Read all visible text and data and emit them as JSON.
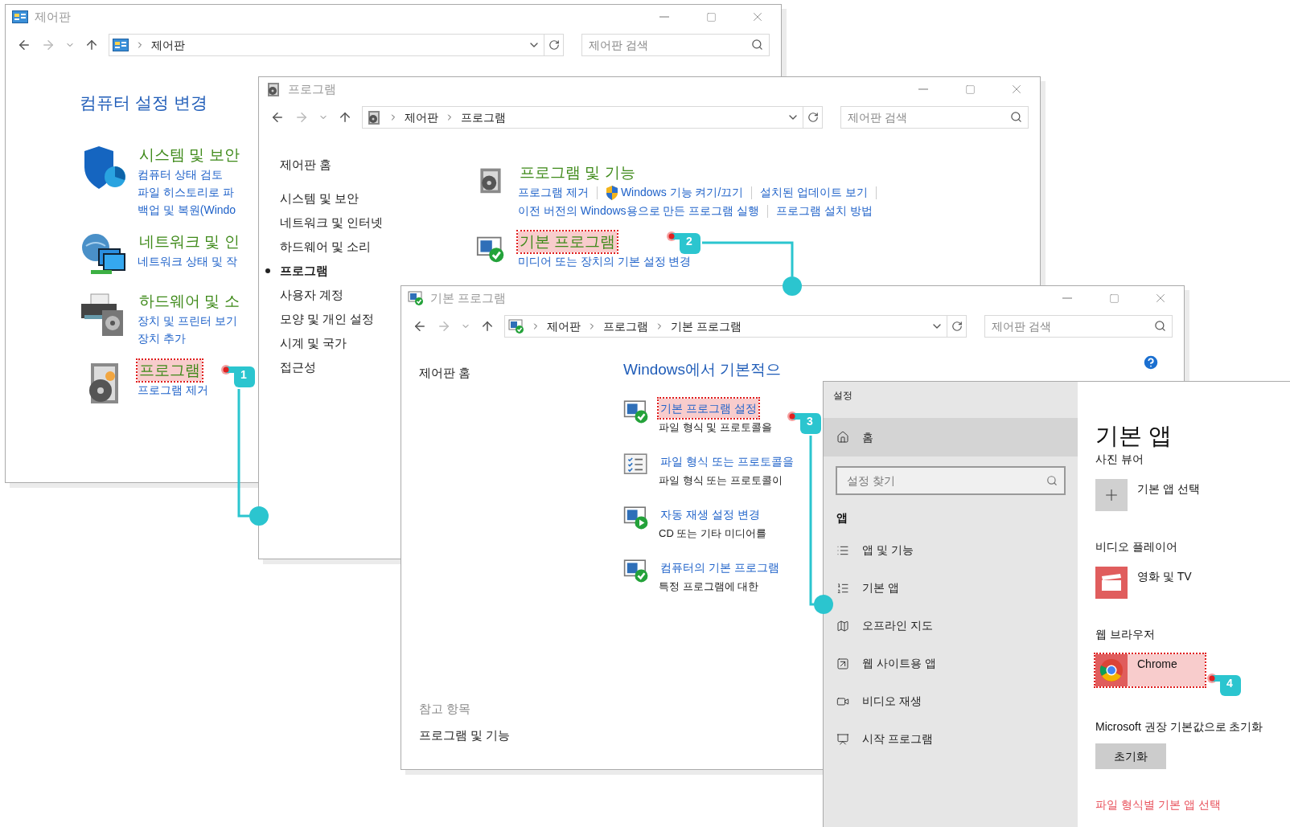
{
  "control_panel": {
    "title": "제어판",
    "breadcrumb": [
      "제어판"
    ],
    "search": {
      "placeholder": "제어판 검색"
    },
    "heading": "컴퓨터 설정 변경",
    "categories": [
      {
        "kind": "security",
        "title": "시스템 및 보안",
        "highlighted": false,
        "links": [
          "컴퓨터 상태 검토",
          "파일 히스토리로 파",
          "백업 및 복원(Windo"
        ]
      },
      {
        "kind": "network",
        "title": "네트워크 및 인",
        "highlighted": false,
        "links": [
          "네트워크 상태 및 작"
        ]
      },
      {
        "kind": "hardware",
        "title": "하드웨어 및 소",
        "highlighted": false,
        "links": [
          "장치 및 프린터 보기",
          "장치 추가"
        ]
      },
      {
        "kind": "programs",
        "title": "프로그램",
        "highlighted": true,
        "links": [
          "프로그램 제거"
        ]
      }
    ]
  },
  "programs_window": {
    "title": "프로그램",
    "breadcrumb": [
      "제어판",
      "프로그램"
    ],
    "search": {
      "placeholder": "제어판 검색"
    },
    "sidebar_home": "제어판 홈",
    "sidebar": [
      {
        "label": "시스템 및 보안",
        "selected": false
      },
      {
        "label": "네트워크 및 인터넷",
        "selected": false
      },
      {
        "label": "하드웨어 및 소리",
        "selected": false
      },
      {
        "label": "프로그램",
        "selected": true
      },
      {
        "label": "사용자 계정",
        "selected": false
      },
      {
        "label": "모양 및 개인 설정",
        "selected": false
      },
      {
        "label": "시계 및 국가",
        "selected": false
      },
      {
        "label": "접근성",
        "selected": false
      }
    ],
    "sections": [
      {
        "kind": "programs",
        "title": "프로그램 및 기능",
        "highlighted": false,
        "link_rows": [
          [
            {
              "label": "프로그램 제거",
              "shield": false
            },
            {
              "label": "Windows 기능 켜기/끄기",
              "shield": true
            },
            {
              "label": "설치된 업데이트 보기",
              "shield": false
            }
          ],
          [
            {
              "label": "이전 버전의 Windows용으로 만든 프로그램 실행",
              "shield": false
            },
            {
              "label": "프로그램 설치 방법",
              "shield": false
            }
          ]
        ]
      },
      {
        "kind": "defaults",
        "title": "기본 프로그램",
        "highlighted": true,
        "link_rows": [
          [
            {
              "label": "미디어 또는 장치의 기본 설정 변경",
              "shield": false
            }
          ]
        ]
      }
    ]
  },
  "default_programs_window": {
    "title": "기본 프로그램",
    "breadcrumb": [
      "제어판",
      "프로그램",
      "기본 프로그램"
    ],
    "search": {
      "placeholder": "제어판 검색"
    },
    "sidebar_home": "제어판 홈",
    "see_also": "참고 항목",
    "see_also_links": [
      "프로그램 및 기능"
    ],
    "heading": "Windows에서 기본적으",
    "items": [
      {
        "kind": "defaults",
        "title": "기본 프로그램 설정",
        "description": "파일 형식 및 프로토콜을",
        "highlighted": true
      },
      {
        "kind": "associations",
        "title": "파일 형식 또는 프로토콜을",
        "description": "파일 형식 또는 프로토콜이",
        "highlighted": false
      },
      {
        "kind": "autoplay",
        "title": "자동 재생 설정 변경",
        "description": "CD 또는 기타 미디어를",
        "highlighted": false
      },
      {
        "kind": "access",
        "title": "컴퓨터의 기본 프로그램",
        "description": "특정 프로그램에 대한",
        "highlighted": false
      }
    ]
  },
  "settings_window": {
    "title": "설정",
    "home": "홈",
    "search": {
      "placeholder": "설정 찾기"
    },
    "section": "앱",
    "nav": [
      {
        "kind": "apps",
        "label": "앱 및 기능"
      },
      {
        "kind": "defaults",
        "label": "기본 앱"
      },
      {
        "kind": "maps",
        "label": "오프라인 지도"
      },
      {
        "kind": "websites",
        "label": "웹 사이트용 앱"
      },
      {
        "kind": "video",
        "label": "비디오 재생"
      },
      {
        "kind": "startup",
        "label": "시작 프로그램"
      }
    ],
    "heading": "기본 앱",
    "groups": [
      {
        "label": "사진 뷰어",
        "app": {
          "kind": "add",
          "name": "기본 앱 선택",
          "highlighted": false
        }
      },
      {
        "label": "비디오 플레이어",
        "app": {
          "kind": "movies",
          "name": "영화 및 TV",
          "highlighted": false
        }
      },
      {
        "label": "웹 브라우저",
        "app": {
          "kind": "chrome",
          "name": "Chrome",
          "highlighted": true
        }
      }
    ],
    "reset_label": "Microsoft 권장 기본값으로 초기화",
    "reset_button": "초기화",
    "link": "파일 형식별 기본 앱 선택"
  },
  "steps": [
    {
      "number": "1"
    },
    {
      "number": "2"
    },
    {
      "number": "3"
    },
    {
      "number": "4"
    }
  ]
}
